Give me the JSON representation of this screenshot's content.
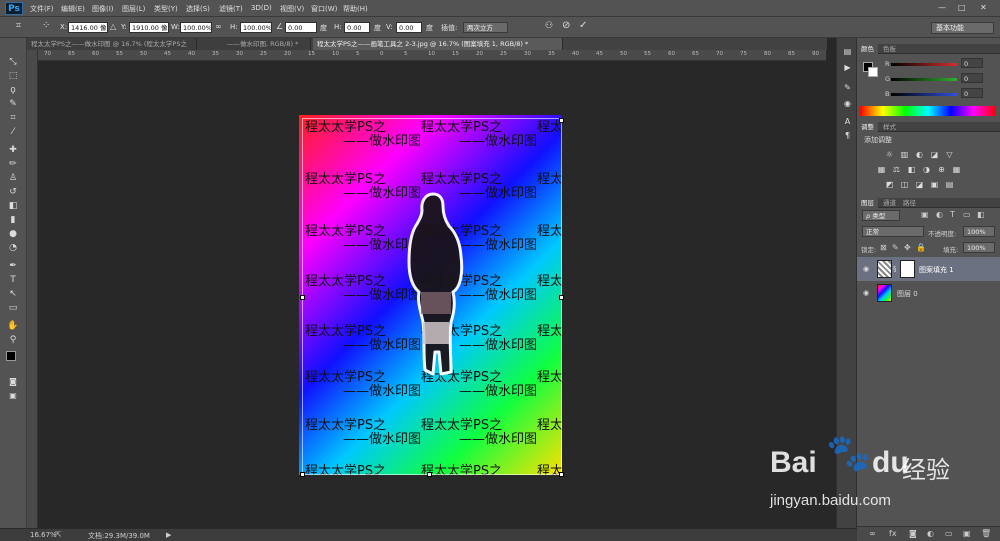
{
  "app": {
    "logo_text": "Ps"
  },
  "menu": [
    "文件(F)",
    "编辑(E)",
    "图像(I)",
    "图层(L)",
    "类型(Y)",
    "选择(S)",
    "滤镜(T)",
    "3D(D)",
    "视图(V)",
    "窗口(W)",
    "帮助(H)"
  ],
  "window_controls": [
    "—",
    "□",
    "✕"
  ],
  "options": {
    "x_label": "X:",
    "x_value": "1416.00 像",
    "y_label": "Y:",
    "y_value": "1910.00 像",
    "w_label": "W:",
    "w_value": "100.00%",
    "h_label": "H:",
    "h_value": "100.00%",
    "angle_value": "0.00",
    "angle_unit": "度",
    "hskew_label": "H:",
    "hskew_value": "0.00",
    "vskew_label": "V:",
    "vskew_value": "0.00",
    "hskew_unit": "度",
    "vskew_unit": "度",
    "interp_label": "插值:",
    "interp_value": "两次立方",
    "workspace": "基本功能"
  },
  "tabs": [
    {
      "label": "程太太学PS之——做水印图 @ 16.7% (程太太学PS之",
      "active": false
    },
    {
      "label": "——做水印图, RGB/8) *",
      "active": false
    },
    {
      "label": "程太太学PS之——画笔工具之 2-3.jpg @ 16.7% (图案填充 1, RGB/8) *",
      "active": true
    }
  ],
  "ruler_top_ticks": [
    "70",
    "65",
    "60",
    "55",
    "50",
    "45",
    "40",
    "35",
    "30",
    "25",
    "20",
    "15",
    "10",
    "5",
    "0",
    "5",
    "10",
    "15",
    "20",
    "25",
    "30",
    "35",
    "40",
    "45",
    "50",
    "55",
    "60",
    "65",
    "70",
    "75",
    "80",
    "85",
    "90"
  ],
  "watermark": {
    "line1": "程太太学PS之",
    "line2": "——做水印图"
  },
  "status": {
    "zoom": "16.67%",
    "doc": "文档:29.3M/39.0M",
    "arrow": "▶"
  },
  "color_panel": {
    "tabs": [
      "颜色",
      "色板"
    ],
    "r_label": "R",
    "g_label": "G",
    "b_label": "B",
    "r_value": "0",
    "g_value": "0",
    "b_value": "0",
    "bar_colors": {
      "r": "#d43030",
      "g": "#30b030",
      "b": "#3050e0"
    }
  },
  "adjust_panel": {
    "tabs": [
      "调整",
      "样式"
    ],
    "heading": "添加调整",
    "icons_row1": [
      "☼",
      "▥",
      "◐",
      "◪",
      "▽"
    ],
    "icons_row2": [
      "▦",
      "⚖",
      "◧",
      "◑",
      "⊕",
      "▦"
    ],
    "icons_row3": [
      "◩",
      "◫",
      "◪",
      "▣",
      "▤"
    ]
  },
  "layers_panel": {
    "tabs": [
      "图层",
      "通道",
      "路径"
    ],
    "filter_label": "ρ 类型",
    "blend_mode": "正常",
    "opacity_label": "不透明度:",
    "opacity_value": "100%",
    "lock_label": "锁定:",
    "fill_label": "填充:",
    "fill_value": "100%",
    "layers": [
      {
        "name": "图案填充 1",
        "selected": true
      },
      {
        "name": "图层 0",
        "selected": false
      }
    ],
    "footer_icons": [
      "∞",
      "fx",
      "◙",
      "◐",
      "▭",
      "▣",
      "🗑"
    ]
  },
  "baidu": {
    "logo_bai": "Bai",
    "logo_du": "du",
    "cn": "经验",
    "url": "jingyan.baidu.com"
  }
}
